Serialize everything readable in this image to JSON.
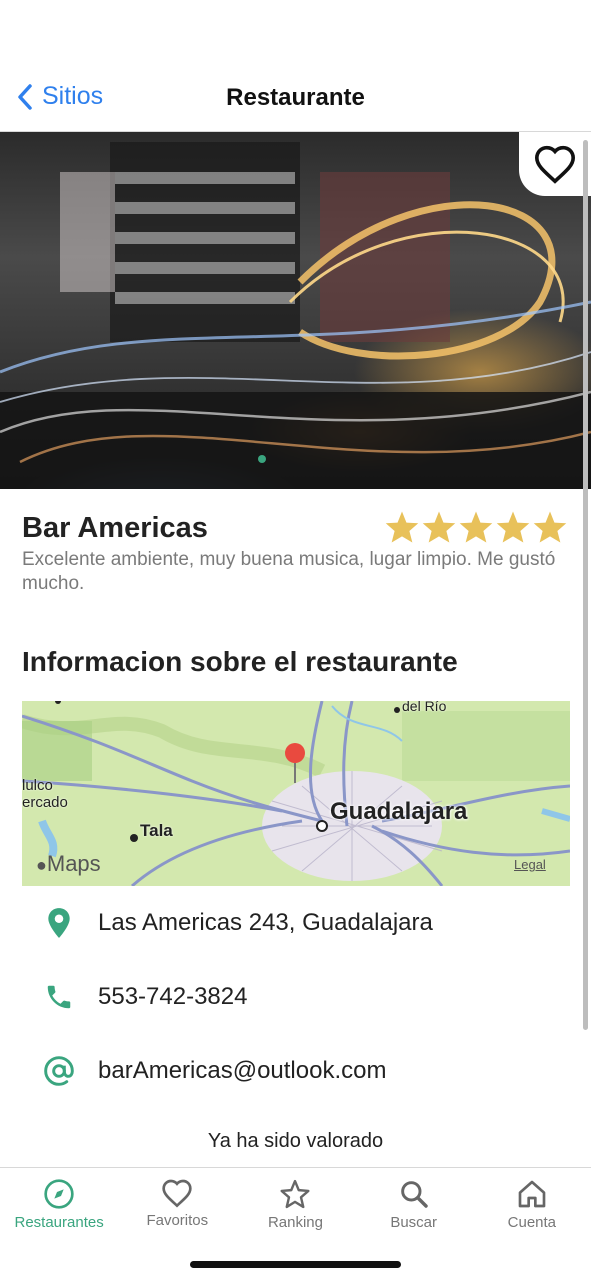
{
  "nav": {
    "back_label": "Sitios",
    "title": "Restaurante"
  },
  "venue": {
    "name": "Bar Americas",
    "rating": 5,
    "rating_max": 5,
    "review": "Excelente ambiente, muy buena musica, lugar limpio. Me gustó mucho."
  },
  "section": {
    "title": "Informacion sobre el restaurante"
  },
  "map": {
    "city_label": "Guadalajara",
    "town_label": "Tala",
    "top_label": "del Río",
    "left_label_1": "lulco",
    "left_label_2": "ercado",
    "brand": "Maps",
    "legal": "Legal"
  },
  "contact": {
    "address": "Las Americas 243, Guadalajara",
    "phone": "553-742-3824",
    "email": "barAmericas@outlook.com"
  },
  "status": {
    "rated_text": "Ya ha sido valorado"
  },
  "tabs": [
    {
      "label": "Restaurantes",
      "icon": "compass-icon",
      "active": true
    },
    {
      "label": "Favoritos",
      "icon": "heart-icon",
      "active": false
    },
    {
      "label": "Ranking",
      "icon": "star-icon",
      "active": false
    },
    {
      "label": "Buscar",
      "icon": "search-icon",
      "active": false
    },
    {
      "label": "Cuenta",
      "icon": "home-icon",
      "active": false
    }
  ],
  "colors": {
    "accent": "#3aa57f",
    "link": "#2f80ed",
    "star": "#e8c15a"
  }
}
